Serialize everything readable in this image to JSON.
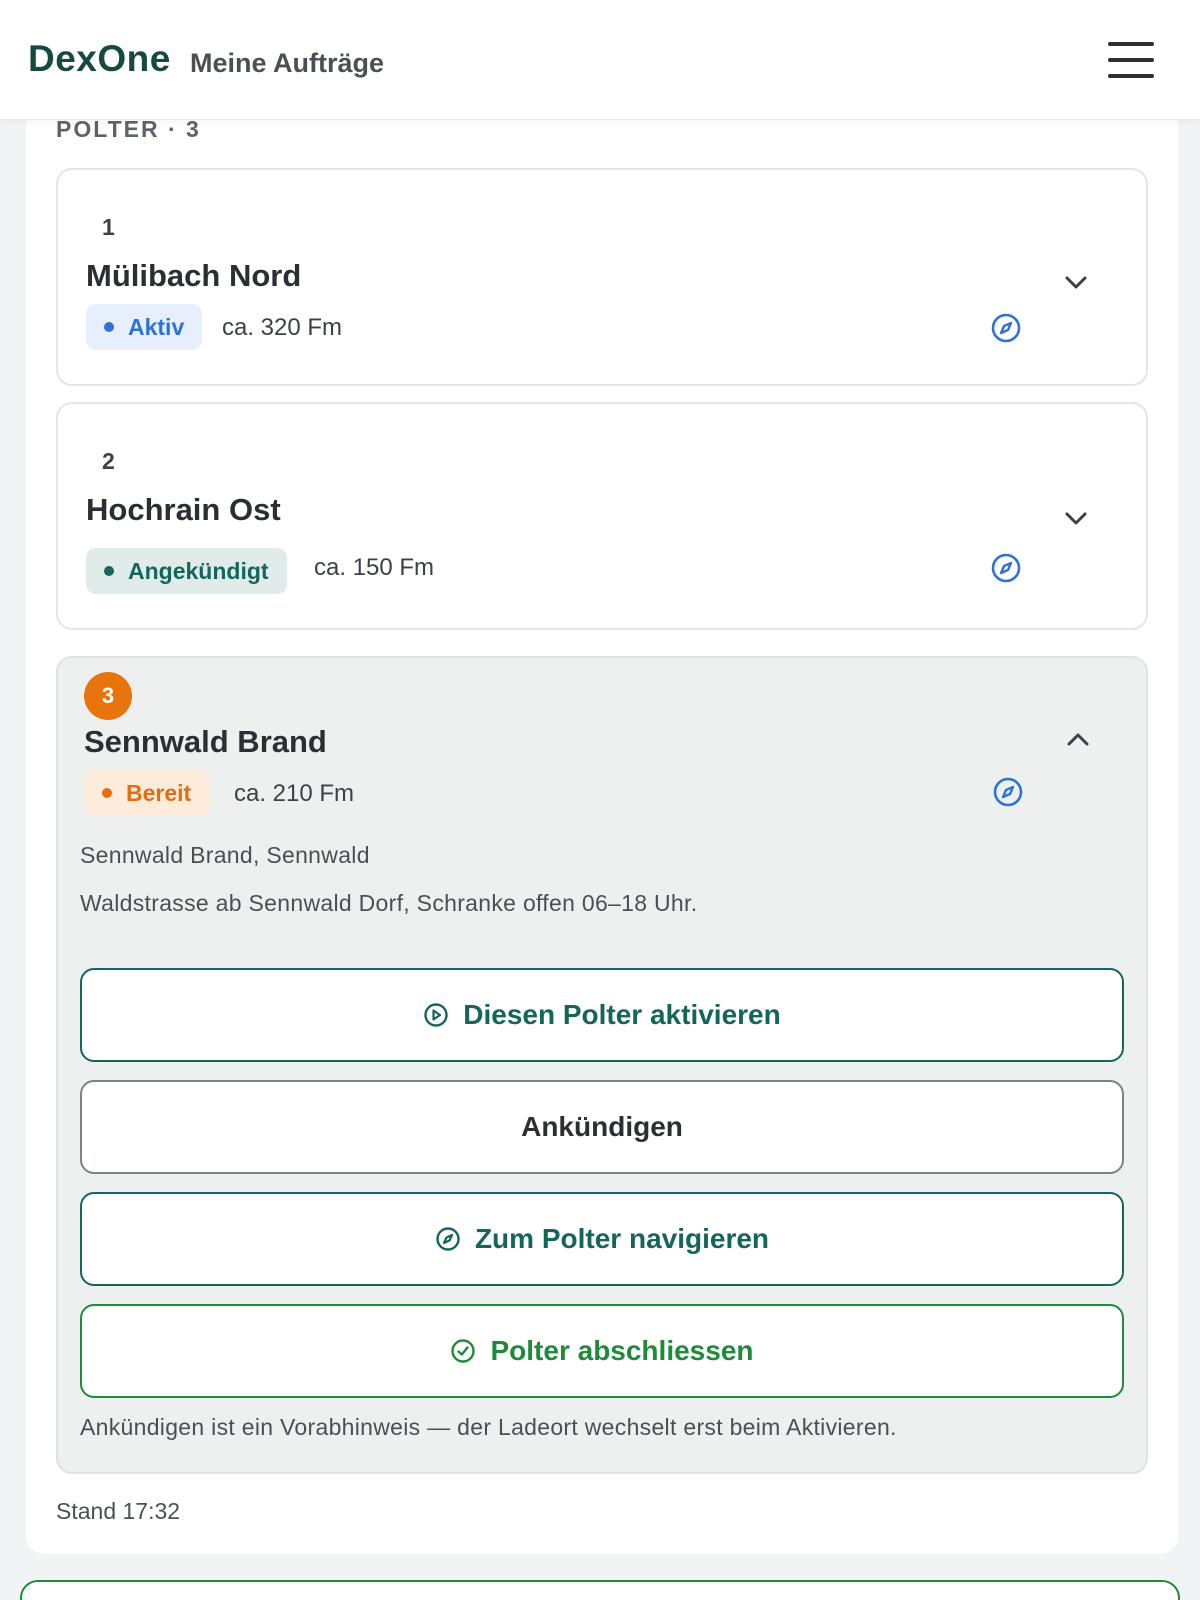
{
  "header": {
    "brand": "DexOne",
    "subtitle": "Meine Aufträge"
  },
  "section": {
    "title": "POLTER · 3"
  },
  "polters": [
    {
      "number": "1",
      "name": "Mülibach Nord",
      "status": "Aktiv",
      "volume": "ca. 320 Fm",
      "expanded": false
    },
    {
      "number": "2",
      "name": "Hochrain Ost",
      "status": "Angekündigt",
      "volume": "ca. 150 Fm",
      "expanded": false
    },
    {
      "number": "3",
      "name": "Sennwald Brand",
      "status": "Bereit",
      "volume": "ca. 210 Fm",
      "expanded": true,
      "location": "Sennwald Brand, Sennwald",
      "access": "Waldstrasse ab Sennwald Dorf, Schranke offen 06–18 Uhr."
    }
  ],
  "actions": {
    "activate": "Diesen Polter aktivieren",
    "announce": "Ankündigen",
    "navigate": "Zum Polter navigieren",
    "close": "Polter abschliessen"
  },
  "hint": "Ankündigen ist ein Vorabhinweis — der Ladeort wechselt erst beim Aktivieren.",
  "footer": {
    "stand": "Stand 17:32"
  },
  "colors": {
    "brand": "#16493f",
    "teal": "#14665a",
    "green": "#1f8a3a",
    "orange": "#e8740c",
    "blue": "#2f72d6"
  },
  "icons": {
    "menu": "hamburger-menu-icon",
    "navigate": "compass-icon",
    "collapse": "chevron-up-icon",
    "expand": "chevron-down-icon",
    "activate": "play-circle-icon",
    "close": "check-circle-icon"
  }
}
